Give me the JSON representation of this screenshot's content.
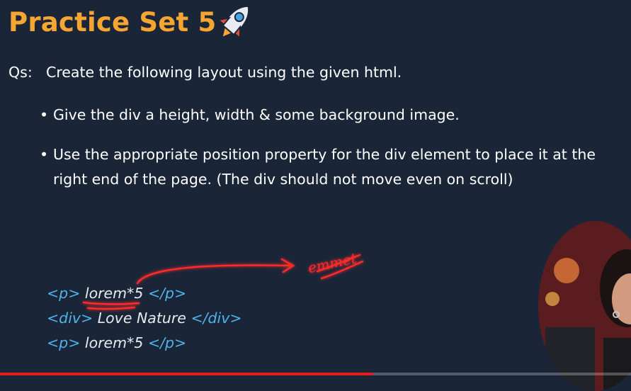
{
  "slide": {
    "title": "Practice Set 5",
    "question_label": "Qs:",
    "question": "Create the following layout using the given html.",
    "bullets": [
      "Give the div a height, width & some background image.",
      "Use the appropriate position property for the div element to place it at the right end of the page. (The div should not move even on scroll)"
    ],
    "code": [
      {
        "open": "<p>",
        "body": " lorem*5 ",
        "close": "</p>"
      },
      {
        "open": "<div>",
        "body": " Love Nature ",
        "close": "</div>"
      },
      {
        "open": "<p>",
        "body": " lorem*5 ",
        "close": "</p>"
      }
    ],
    "annotation": "emmet"
  },
  "video": {
    "progress_fraction": 0.59
  },
  "icons": [
    "rocket-icon"
  ],
  "colors": {
    "background": "#1a2638",
    "title": "#f5a531",
    "code_tag": "#4fb3ea",
    "annotation": "#ff2a2a",
    "progress": "#e31b1b"
  }
}
